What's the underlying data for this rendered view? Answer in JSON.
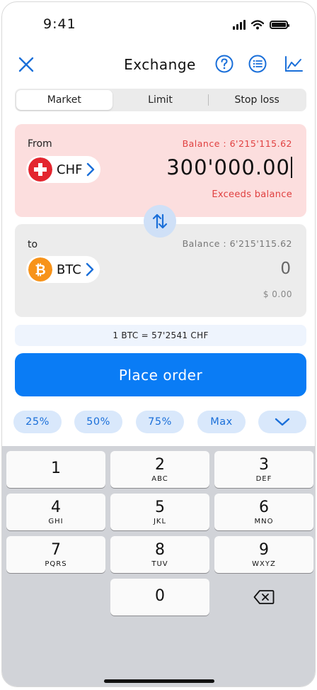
{
  "status": {
    "time": "9:41"
  },
  "nav": {
    "title": "Exchange",
    "close_icon": "close-icon",
    "help_icon": "help-icon",
    "list_icon": "list-icon",
    "chart_icon": "chart-icon"
  },
  "tabs": [
    {
      "label": "Market",
      "active": true
    },
    {
      "label": "Limit",
      "active": false
    },
    {
      "label": "Stop loss",
      "active": false
    }
  ],
  "from": {
    "label": "From",
    "balance": "Balance : 6'215'115.62",
    "currency": "CHF",
    "amount": "300'000.00",
    "warning": "Exceeds balance"
  },
  "to": {
    "label": "to",
    "balance": "Balance : 6'215'115.62",
    "currency": "BTC",
    "amount": "0",
    "fiat_value": "$ 0.00"
  },
  "rate": "1 BTC = 57'2541 CHF",
  "primary_button": "Place order",
  "quick_amounts": [
    "25%",
    "50%",
    "75%",
    "Max"
  ],
  "keypad": [
    {
      "digit": "1",
      "letters": ""
    },
    {
      "digit": "2",
      "letters": "ABC"
    },
    {
      "digit": "3",
      "letters": "DEF"
    },
    {
      "digit": "4",
      "letters": "GHI"
    },
    {
      "digit": "5",
      "letters": "JKL"
    },
    {
      "digit": "6",
      "letters": "MNO"
    },
    {
      "digit": "7",
      "letters": "PQRS"
    },
    {
      "digit": "8",
      "letters": "TUV"
    },
    {
      "digit": "9",
      "letters": "WXYZ"
    },
    {
      "digit": "0",
      "letters": ""
    }
  ],
  "colors": {
    "accent": "#0a7cf5",
    "error": "#e04040",
    "from_bg": "#fcdede",
    "to_bg": "#ececec",
    "chf_red": "#e3262f",
    "btc_orange": "#f7931a"
  }
}
